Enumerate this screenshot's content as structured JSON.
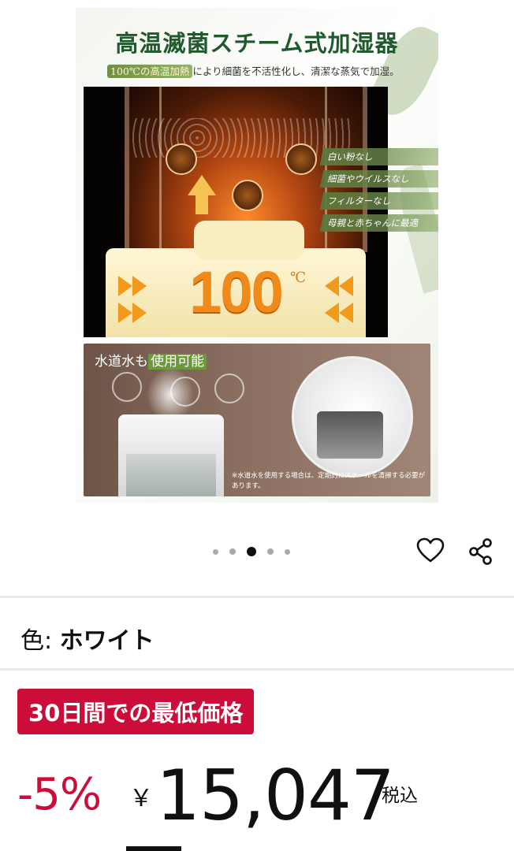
{
  "product_image": {
    "title": "高温滅菌スチーム式加湿器",
    "subtitle_highlight": "100℃の高温加熱",
    "subtitle_rest": "により細菌を不活性化し、清潔な蒸気で加湿。",
    "temperature_value": "100",
    "temperature_unit": "℃",
    "features": [
      "白い粉なし",
      "細菌やウイルスなし",
      "フィルターなし",
      "母親と赤ちゃんに最適"
    ],
    "tap_water_prefix": "水道水も",
    "tap_water_highlight": "使用可能",
    "tap_water_note": "※水道水を使用する場合は、定期的にスケールを清掃する必要があります。"
  },
  "carousel": {
    "total_images": 5,
    "active_index": 2
  },
  "actions": {
    "favorite_icon": "heart-icon",
    "share_icon": "share-icon"
  },
  "color": {
    "label": "色:",
    "value": "ホワイト"
  },
  "deal": {
    "badge": "30日間での最低価格",
    "badge_color": "#cc0c39"
  },
  "price": {
    "discount": "-5%",
    "currency": "￥",
    "amount": "15,047",
    "tax_label": "税込",
    "discount_color": "#cc0c39"
  }
}
